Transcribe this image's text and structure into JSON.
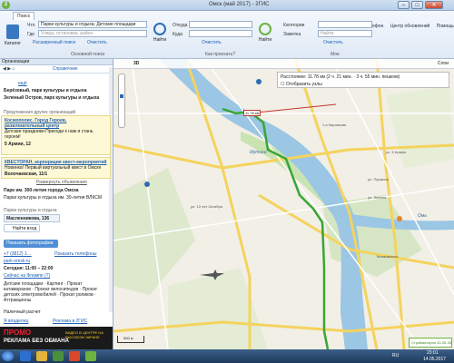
{
  "app": {
    "title": "Омск (май 2017) - 2ГИС",
    "logo": "2"
  },
  "window": {
    "min": "–",
    "max": "□",
    "close": "✕"
  },
  "topright": {
    "show_phone": "Проявить телефон",
    "help_center": "Центр обновлений",
    "help": "Помощь"
  },
  "ribbon": {
    "tabs": [
      "Поиск"
    ],
    "catalog_label": "Каталог",
    "what_label": "Что",
    "what_value": "Парки культуры и отдыха; Детские площадки",
    "where_label": "Где",
    "where_placeholder": "Улица, остановка, район",
    "adv_search": "Расширенный поиск",
    "clear": "Очистить",
    "find": "Найти",
    "from_label": "Откуда",
    "to_label": "Куда",
    "find_route": "Найти",
    "clear_route": "Очистить",
    "categories_label": "Категории",
    "bookmark_label": "Заметка",
    "bookmark_placeholder": "Найти",
    "clear_notes": "Очистить",
    "groups": [
      "Основной поиск",
      "Как проехать?",
      "Мое"
    ]
  },
  "panel": {
    "header": "Организации",
    "toolbar": {
      "back": "Справочник"
    },
    "org_count": "ещё",
    "heading1": "Берёзовый, парк культуры и отдыха",
    "heading2": "Зеленый Остров, парк культуры и отдыха",
    "promo_label": "Предложения других организаций",
    "promo1_title": "Космополис. Город Героев, развлекательный центр",
    "promo1_text": "Детские праздники Приходи к нам и стань героем!",
    "promo1_addr": "5 Армии, 12",
    "promo2_title": "КВЕСТОРАН, корпорация квест-мероприятий",
    "promo2_text": "Новинка! Первый виртуальный квест в Омске",
    "promo2_addr": "Волочаевская, 11/1",
    "collapse": "Развернуть объявления",
    "card_title": "Парк им. 300-летия города Омска",
    "card_sub": "Парки культуры и отдыха им. 30-летия ВЛКСМ",
    "card_sub2": "Парки культуры и отдыха",
    "address": "Масленникова, 136",
    "route_btn": "Найти вход",
    "photos_btn": "Показать фотографии",
    "phone": "+7 (3812) 1…",
    "phone_hint": "Показать телефоны",
    "site": "park-omsk.ru",
    "hours": "Сегодня: 11:00 – 22:00",
    "tag": "Сейчас на Флампе (7)",
    "features_head": "Детские площадки",
    "features": "Картинг · Прокат катамаранов · Прокат велосипедов · Прокат детских электромобилей · Прокат роликов · Аттракционы",
    "pay": "Наличный расчет",
    "owner": "Я владелец",
    "rubrics": "Реклама в 2ГИС"
  },
  "ad": {
    "brand": "ПРОМО",
    "slogan": "РЕКЛАМА БЕЗ ОБМАНА",
    "side": "ВИДЕО В ЦЕНТРЕ НА ВЫСОКОМ ЭКРАНЕ"
  },
  "map": {
    "distance": "Расстояние: 11.78 км (2 ч. 21 мин. · 3 ч. 55 мин. пешком)",
    "map_mode": "3D",
    "map_menu": "Слои",
    "ruler_label": "11.78 км",
    "show_nodes": "Отобразить узлы",
    "scale": "500 м",
    "district_labels": [
      "1-я Кировская",
      "ул. 10 лет Октября",
      "ул. Пушкина",
      "ул. Ленина",
      "Иртыш",
      "Омь",
      "Маяковского",
      "ул. 5 Армии"
    ],
    "bottom_right": "Стройматерия 43-05-35"
  },
  "taskbar": {
    "lang": "RU",
    "time": "23:01",
    "date": "14.05.2017"
  },
  "colors": {
    "accent": "#2e6bb5",
    "river": "#9bc6e4",
    "park": "#c9e3b2",
    "road": "#f4d35e",
    "route": "#3aa535",
    "ruler": "#c0392b"
  }
}
